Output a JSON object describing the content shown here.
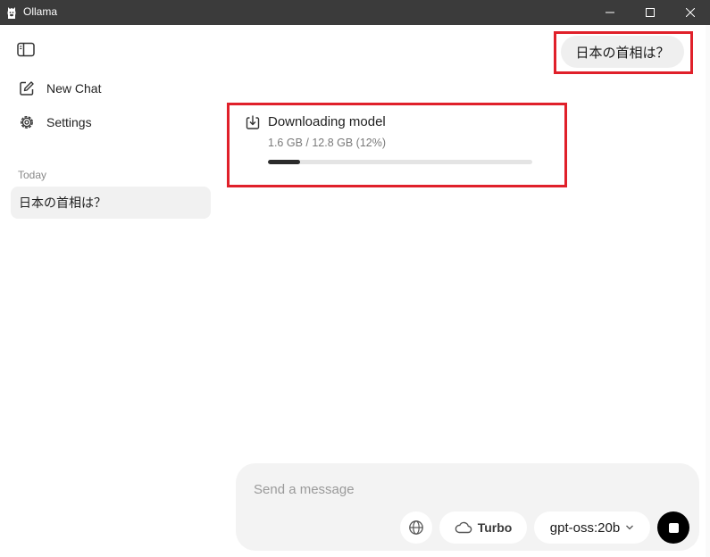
{
  "window": {
    "title": "Ollama",
    "app_icon": "ollama-llama-icon",
    "controls": {
      "minimize_icon": "minimize-icon",
      "maximize_icon": "maximize-icon",
      "close_icon": "close-icon"
    }
  },
  "sidebar": {
    "toggle_icon": "sidebar-toggle-icon",
    "new_chat_label": "New Chat",
    "new_chat_icon": "compose-icon",
    "settings_label": "Settings",
    "settings_icon": "gear-icon",
    "section_label": "Today",
    "chats": [
      {
        "label": "日本の首相は？"
      }
    ]
  },
  "conversation": {
    "user_message": "日本の首相は？",
    "download": {
      "icon": "download-icon",
      "title": "Downloading model",
      "status": "1.6 GB / 12.8 GB (12%)",
      "progress_percent": 12
    }
  },
  "composer": {
    "placeholder": "Send a message",
    "value": "",
    "web_search_icon": "globe-icon",
    "turbo_label": "Turbo",
    "turbo_icon": "cloud-icon",
    "model_label": "gpt-oss:20b",
    "model_dropdown_icon": "chevron-down-icon",
    "stop_icon": "stop-icon"
  },
  "colors": {
    "titlebar": "#3b3b3b",
    "highlight": "#e0202a",
    "progress_fill": "#2b2b2b",
    "progress_track": "#e4e4e4"
  }
}
